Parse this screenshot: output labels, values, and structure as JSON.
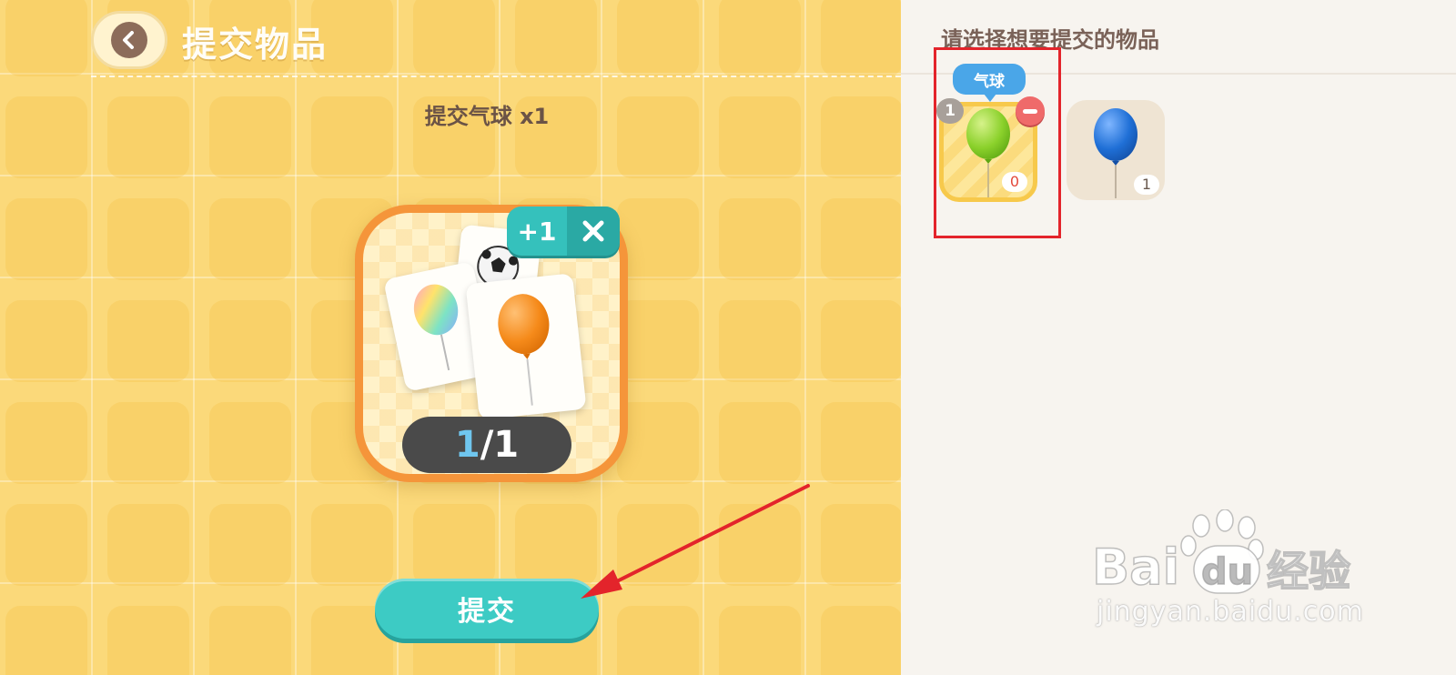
{
  "header": {
    "title": "提交物品"
  },
  "requirement": {
    "text": "提交气球 x1"
  },
  "item_card": {
    "add_label": "+1",
    "counter_current": "1",
    "counter_separator": "/",
    "counter_total": "1"
  },
  "submit": {
    "label": "提交"
  },
  "selection_panel": {
    "title": "请选择想要提交的物品",
    "tooltip": "气球",
    "slots": [
      {
        "name": "green-balloon",
        "color": "#8bd12b",
        "selected_count": "1",
        "count": "0",
        "selected": true
      },
      {
        "name": "blue-balloon",
        "color": "#1f6fd6",
        "count": "1",
        "selected": false
      }
    ]
  },
  "watermark": {
    "logo_text": "Bai du 经验",
    "url": "jingyan.baidu.com"
  },
  "colors": {
    "background_yellow": "#fbd97a",
    "accent_teal": "#3dcbc4",
    "card_orange": "#f5953a",
    "annotation_red": "#e3242b"
  }
}
